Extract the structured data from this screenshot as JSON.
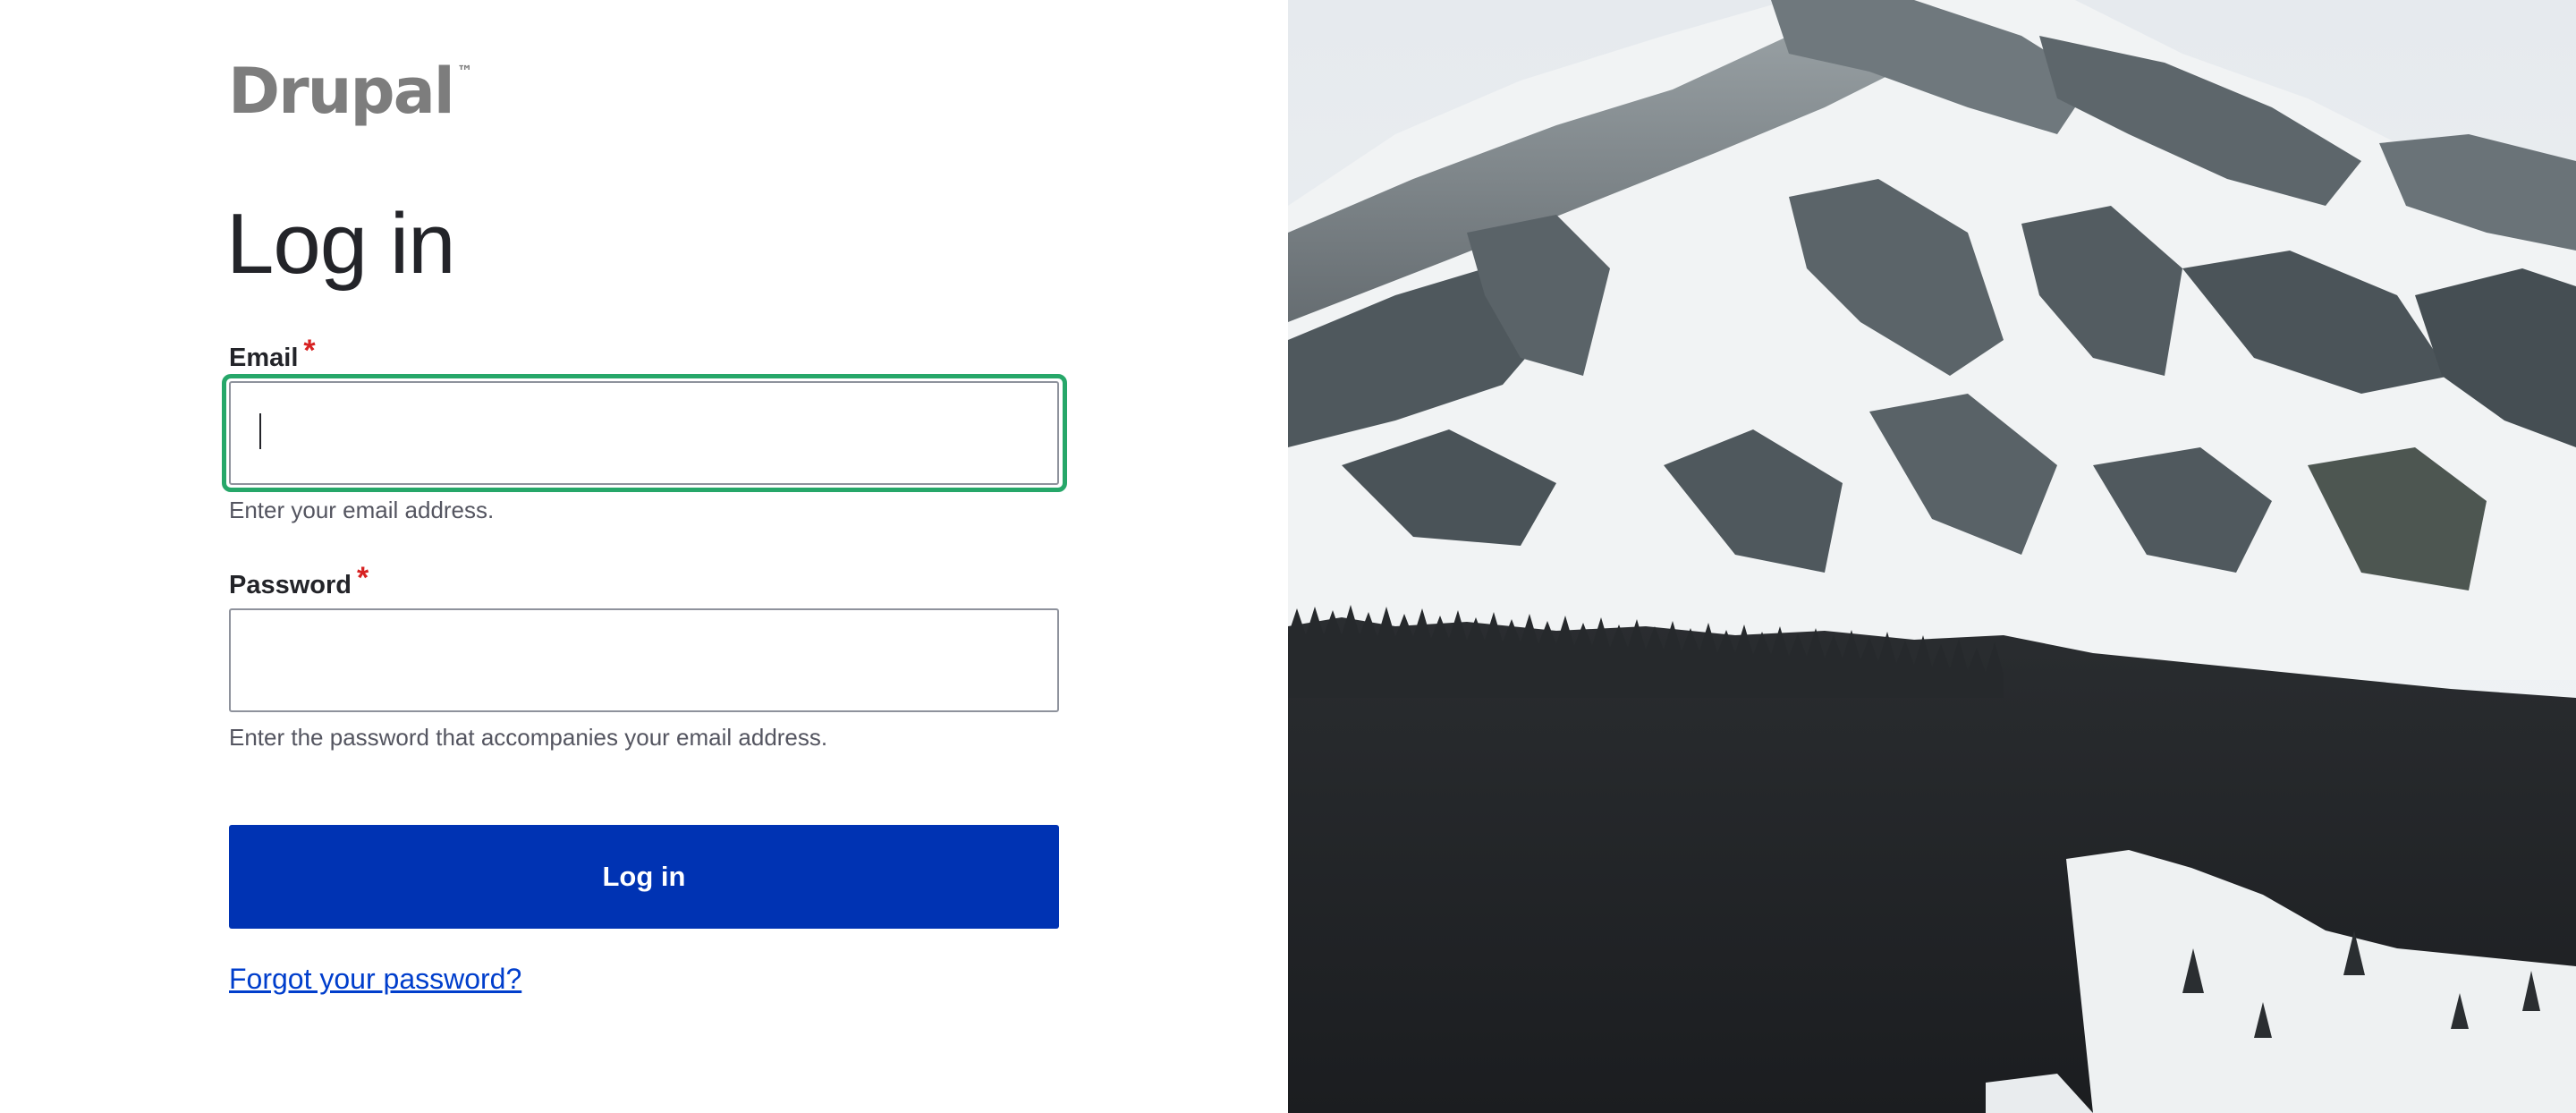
{
  "brand": {
    "logo_text": "Drupal",
    "logo_tm": "™"
  },
  "form": {
    "title": "Log in",
    "email": {
      "label": "Email",
      "required_mark": "*",
      "value": "",
      "description": "Enter your email address."
    },
    "password": {
      "label": "Password",
      "required_mark": "*",
      "value": "",
      "description": "Enter the password that accompanies your email address."
    },
    "submit_label": "Log in",
    "forgot_link": "Forgot your password?"
  },
  "colors": {
    "primary_button": "#0033b3",
    "link": "#003ecc",
    "focus_ring": "#26a769",
    "required": "#d72222",
    "text": "#232429"
  },
  "background_image": {
    "icon": "snowy-mountain-forest-photo"
  }
}
